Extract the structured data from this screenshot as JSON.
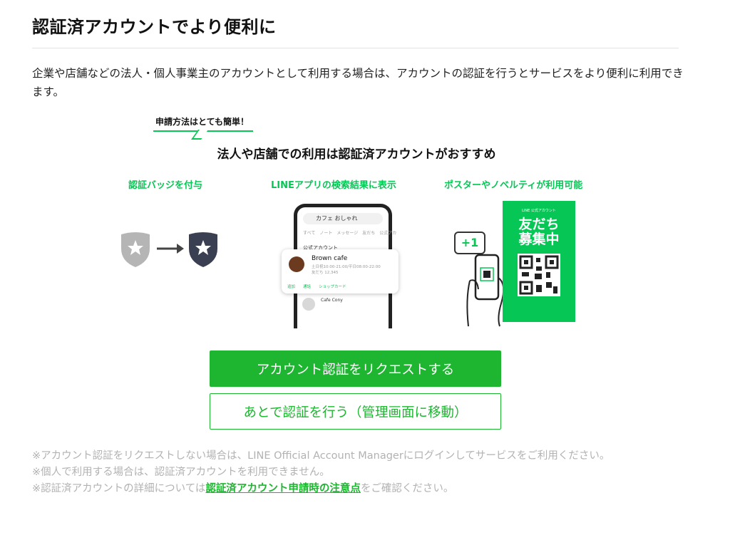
{
  "header": {
    "title": "認証済アカウントでより便利に"
  },
  "intro": {
    "text": "企業や店舗などの法人・個人事業主のアカウントとして利用する場合は、アカウントの認証を行うとサービスをより便利に利用できます。"
  },
  "illustration": {
    "bubble": "申請方法はとても簡単！",
    "headline": "法人や店舗での利用は認証済アカウントがおすすめ",
    "features": [
      "認証バッジを付与",
      "LINEアプリの検索結果に表示",
      "ポスターやノベルティが利用可能"
    ],
    "phone": {
      "search": "カフェ おしゃれ",
      "tabs": "すべて　ノート　メッセージ　友だち　公式アカ",
      "section": "公式アカウント",
      "card_name": "Brown cafe",
      "card_detail": "土日祝10:00-21:00/平日08:00-22:00",
      "card_friends": "友だち 12,345",
      "card_actions": "追加　　通話　　ショップカード",
      "card2_name": "Cafe Cony"
    },
    "plus_one": "+1",
    "poster": {
      "small": "LINE 公式アカウント",
      "line1": "友だち",
      "line2": "募集中"
    },
    "colors": {
      "accent": "#06c755",
      "badge_dark": "#3a3f52",
      "badge_gray": "#b5b5b5"
    }
  },
  "actions": {
    "primary": "アカウント認証をリクエストする",
    "secondary": "あとで認証を行う（管理画面に移動）"
  },
  "notes": {
    "note1": "※アカウント認証をリクエストしない場合は、LINE Official Account Managerにログインしてサービスをご利用ください。",
    "note2": "※個人で利用する場合は、認証済アカウントを利用できません。",
    "note3_prefix": "※認証済アカウントの詳細については",
    "note3_link": "認証済アカウント申請時の注意点",
    "note3_suffix": "をご確認ください。"
  }
}
